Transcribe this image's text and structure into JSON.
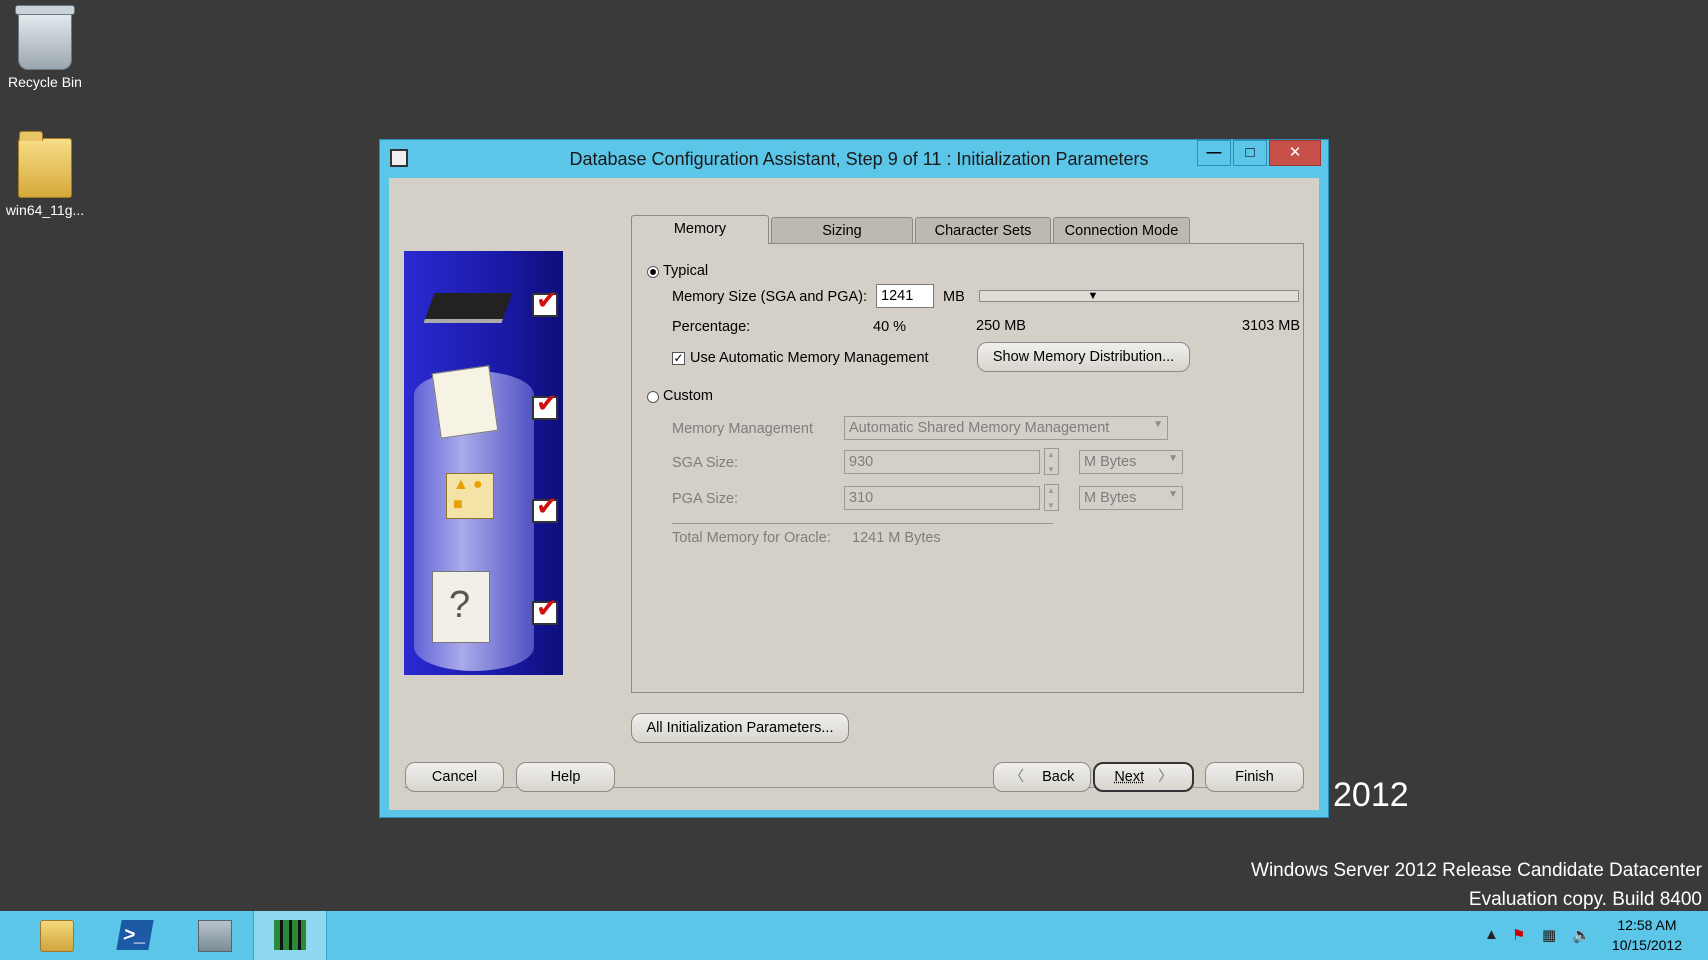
{
  "desktop": {
    "icons": [
      {
        "label": "Recycle Bin",
        "icon": "recycle-bin-icon"
      },
      {
        "label": "win64_11g...",
        "icon": "folder-icon"
      }
    ],
    "brand_year": "2012",
    "build_line1": "Windows Server 2012 Release Candidate Datacenter",
    "build_line2": "Evaluation copy. Build 8400"
  },
  "window": {
    "title": "Database Configuration Assistant, Step 9 of 11 : Initialization Parameters",
    "controls": {
      "minimize": "—",
      "maximize": "□",
      "close": "✕"
    }
  },
  "tabs": [
    {
      "label": "Memory",
      "active": true
    },
    {
      "label": "Sizing",
      "active": false
    },
    {
      "label": "Character Sets",
      "active": false
    },
    {
      "label": "Connection Mode",
      "active": false
    }
  ],
  "memory": {
    "typical_label": "Typical",
    "typical_selected": true,
    "memory_size_label": "Memory Size (SGA and PGA):",
    "memory_size_value": "1241",
    "memory_size_unit": "MB",
    "percentage_label": "Percentage:",
    "percentage_value": "40 %",
    "slider_min": "250 MB",
    "slider_max": "3103 MB",
    "slider_fraction": 0.348,
    "amm_label": "Use Automatic Memory Management",
    "amm_checked": true,
    "show_distribution_button": "Show Memory Distribution...",
    "custom_label": "Custom",
    "custom_selected": false,
    "memory_management_label": "Memory Management",
    "memory_management_value": "Automatic Shared Memory Management",
    "sga_label": "SGA Size:",
    "sga_value": "930",
    "sga_unit": "M Bytes",
    "pga_label": "PGA Size:",
    "pga_value": "310",
    "pga_unit": "M Bytes",
    "total_label": "Total Memory for Oracle:",
    "total_value": "1241 M Bytes"
  },
  "buttons": {
    "all_params": "All Initialization Parameters...",
    "cancel": "Cancel",
    "help": "Help",
    "back": "Back",
    "next": "Next",
    "finish": "Finish"
  },
  "taskbar": {
    "items": [
      {
        "icon": "file-explorer-icon"
      },
      {
        "icon": "powershell-icon"
      },
      {
        "icon": "server-manager-icon"
      },
      {
        "icon": "dbca-icon",
        "active": true
      }
    ],
    "clock_time": "12:58 AM",
    "clock_date": "10/15/2012"
  },
  "colors": {
    "desktop": "#3a3a3a",
    "window_frame": "#5bc6e8",
    "close_button": "#c7504a",
    "dialog_bg": "#d4d0c8"
  }
}
